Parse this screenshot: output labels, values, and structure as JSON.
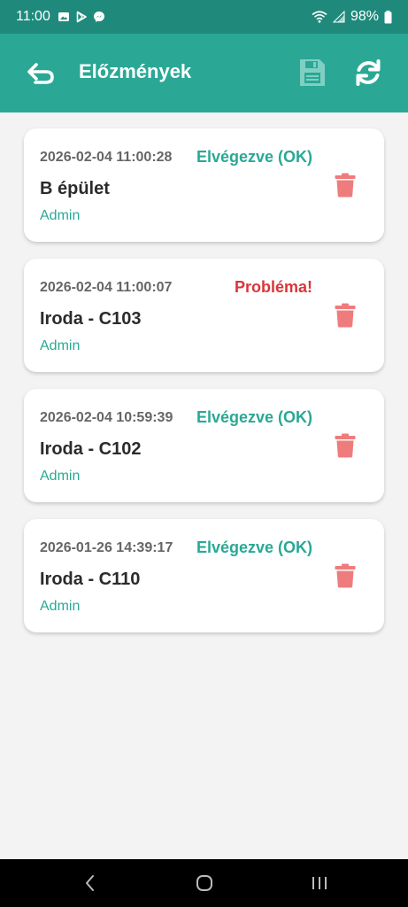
{
  "status_bar": {
    "time": "11:00",
    "battery": "98%",
    "icons": [
      "gallery-icon",
      "play-store-icon",
      "messenger-icon",
      "wifi-icon",
      "signal-icon",
      "battery-icon"
    ]
  },
  "app_bar": {
    "title": "Előzmények",
    "icons": [
      "back-arrow-icon",
      "save-icon",
      "refresh-icon"
    ],
    "colors": {
      "app_bar": "#2aa895",
      "status_bar": "#1f8a7c",
      "save_icon": "#7fcfc2"
    }
  },
  "history": {
    "items": [
      {
        "timestamp": "2026-02-04 11:00:28",
        "status": "Elvégezve (OK)",
        "status_type": "ok",
        "location": "B épület",
        "user": "Admin"
      },
      {
        "timestamp": "2026-02-04 11:00:07",
        "status": "Probléma!",
        "status_type": "problem",
        "location": "Iroda - C103",
        "user": "Admin"
      },
      {
        "timestamp": "2026-02-04 10:59:39",
        "status": "Elvégezve (OK)",
        "status_type": "ok",
        "location": "Iroda - C102",
        "user": "Admin"
      },
      {
        "timestamp": "2026-01-26 14:39:17",
        "status": "Elvégezve (OK)",
        "status_type": "ok",
        "location": "Iroda - C110",
        "user": "Admin"
      }
    ],
    "colors": {
      "ok": "#2aa895",
      "problem": "#d9353a",
      "trash": "#ef7c7c"
    }
  }
}
